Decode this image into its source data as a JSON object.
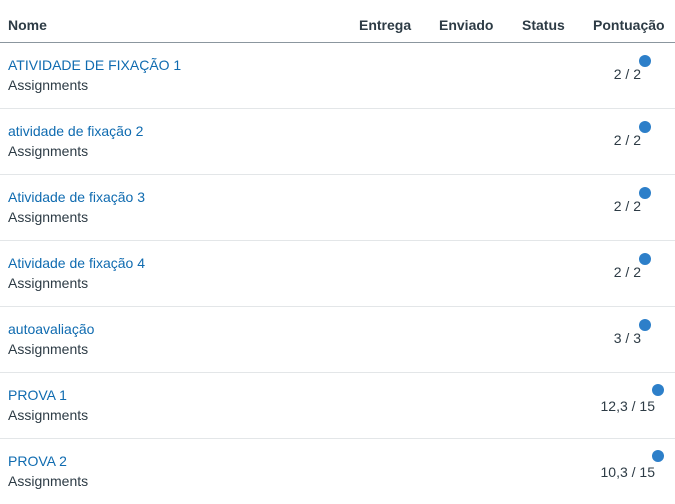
{
  "header": {
    "name": "Nome",
    "due": "Entrega",
    "submitted": "Enviado",
    "status": "Status",
    "score": "Pontuação"
  },
  "rows": [
    {
      "title": "ATIVIDADE DE FIXAÇÃO 1",
      "group": "Assignments",
      "score": "2 / 2"
    },
    {
      "title": "atividade de fixação 2",
      "group": "Assignments",
      "score": "2 / 2"
    },
    {
      "title": "Atividade de fixação 3",
      "group": "Assignments",
      "score": "2 / 2"
    },
    {
      "title": "Atividade de fixação 4",
      "group": "Assignments",
      "score": "2 / 2"
    },
    {
      "title": "autoavaliação",
      "group": "Assignments",
      "score": "3 / 3"
    },
    {
      "title": "PROVA 1",
      "group": "Assignments",
      "score": "12,3 / 15"
    },
    {
      "title": "PROVA 2",
      "group": "Assignments",
      "score": "10,3 / 15"
    }
  ],
  "colors": {
    "link": "#0f6bb0",
    "unread_dot": "#2d7fc9",
    "text": "#2d3b45"
  },
  "icons": {
    "unread": "unread-comment-dot"
  }
}
